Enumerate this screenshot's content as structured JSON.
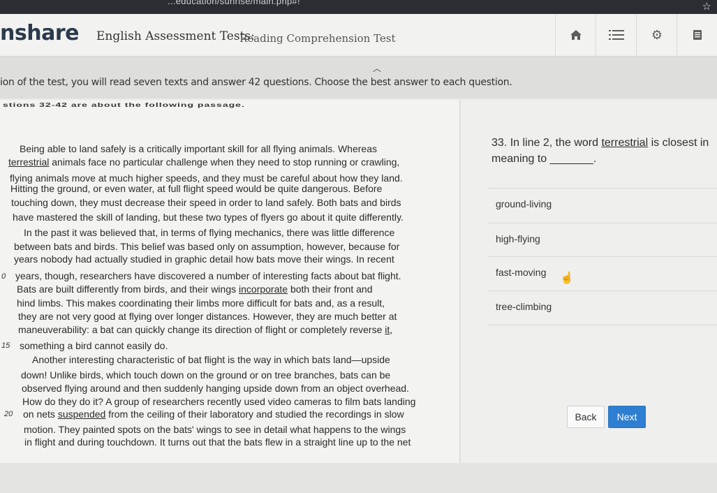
{
  "browser": {
    "url_fragment": "...education/sunrise/main.php#!"
  },
  "header": {
    "brand": "nshare",
    "crumb_section": "English Assessment Tests:",
    "crumb_test": "Reading Comprehension Test"
  },
  "instructions": {
    "text": "ion of the test, you will read seven texts and answer 42 questions. Choose the best answer to each question."
  },
  "passage": {
    "heading": "stions 32-42 are about the following passage.",
    "lines": [
      "Being able to land safely is a critically important skill for all flying animals. Whereas",
      "terrestrial animals face no particular challenge when they need to stop running or crawling,",
      "flying animals move at much higher speeds, and they must be careful about how they land.",
      "Hitting the ground, or even water, at full flight speed would be quite dangerous. Before",
      "touching down, they must decrease their speed in order to land safely. Both bats and birds",
      "have mastered the skill of landing, but these two types of flyers go about it quite differently.",
      "In the past it was believed that, in terms of flying mechanics, there was little difference",
      "between bats and birds. This belief was based only on assumption, however, because for",
      "years nobody had actually studied in graphic detail how bats move their wings. In recent",
      "years, though, researchers have discovered a number of interesting facts about bat flight.",
      "Bats are built differently from birds, and their wings incorporate both their front and",
      "hind limbs. This makes coordinating their limbs more difficult for bats and, as a result,",
      "they are not very good at flying over longer distances. However, they are much better at",
      "maneuverability: a bat can quickly change its direction of flight or completely reverse it,",
      "something a bird cannot easily do.",
      "Another interesting characteristic of bat flight is the way in which bats land—upside",
      "down! Unlike birds, which touch down on the ground or on tree branches, bats can be",
      "observed flying around and then suddenly hanging upside down from an object overhead.",
      "How do they do it? A group of researchers recently used video cameras to film bats landing",
      "on nets suspended from the ceiling of their laboratory and studied the recordings in slow",
      "motion. They painted spots on the bats' wings to see in detail what happens to the wings",
      "in flight and during touchdown. It turns out that the bats flew in a straight line up to the net"
    ],
    "line_numbers": [
      "0",
      "15",
      "20"
    ]
  },
  "question": {
    "number": "33.",
    "text_before": "In line 2, the word",
    "keyword": "terrestrial",
    "text_after": "is closest in meaning to _______.",
    "options": [
      "ground-living",
      "high-flying",
      "fast-moving",
      "tree-climbing"
    ]
  },
  "nav": {
    "back_label": "Back",
    "next_label": "Next"
  }
}
